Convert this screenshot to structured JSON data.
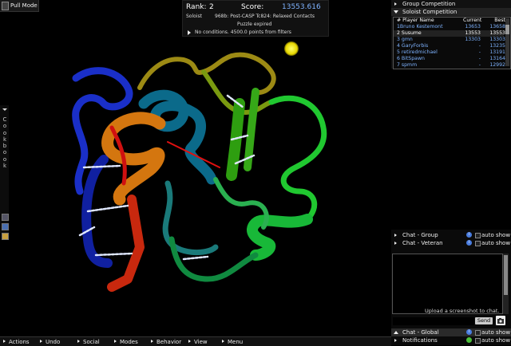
{
  "pull_mode": {
    "label": "Pull Mode"
  },
  "info": {
    "rank_label": "Rank:",
    "rank_value": "2",
    "score_label": "Score:",
    "score_value": "13553.616",
    "mode": "Soloist",
    "puzzle_title": "968b: Post-CASP Tc824: Relaxed Contacts",
    "status": "Puzzle expired",
    "conditions": "No conditions. 4500.0 points from filters"
  },
  "competition": {
    "group_header": "Group Competition",
    "soloist_header": "Soloist Competition",
    "columns": [
      "# Player Name",
      "Current",
      "Best"
    ],
    "rows": [
      {
        "name": "1Bruno Kestemont",
        "current": "13653",
        "best": "13658"
      },
      {
        "name": "2 Susume",
        "current": "13553",
        "best": "13553"
      },
      {
        "name": "3 gmn",
        "current": "13303",
        "best": "13303"
      },
      {
        "name": "4 GaryForbis",
        "current": "-",
        "best": "13235"
      },
      {
        "name": "5 retiredmichael",
        "current": "-",
        "best": "13191"
      },
      {
        "name": "6 BitSpawn",
        "current": "-",
        "best": "13164"
      },
      {
        "name": "7 spmm",
        "current": "-",
        "best": "12992"
      }
    ]
  },
  "cookbook": {
    "label": "Cookbook"
  },
  "chat": {
    "group_label": "Chat - Group",
    "veteran_label": "Chat - Veteran",
    "global_label": "Chat - Global",
    "notifications_label": "Notifications",
    "auto_show": "auto show",
    "info_glyph": "i",
    "upload_text": "Upload a screenshot to chat.",
    "send_label": "Send"
  },
  "bottom_menu": [
    "Actions",
    "Undo",
    "Social",
    "Modes",
    "Behavior",
    "View",
    "Menu"
  ],
  "colors": {
    "accent_blue": "#7fb3ff",
    "info_blue": "#4a7de0",
    "info_green": "#4cbf3a"
  }
}
